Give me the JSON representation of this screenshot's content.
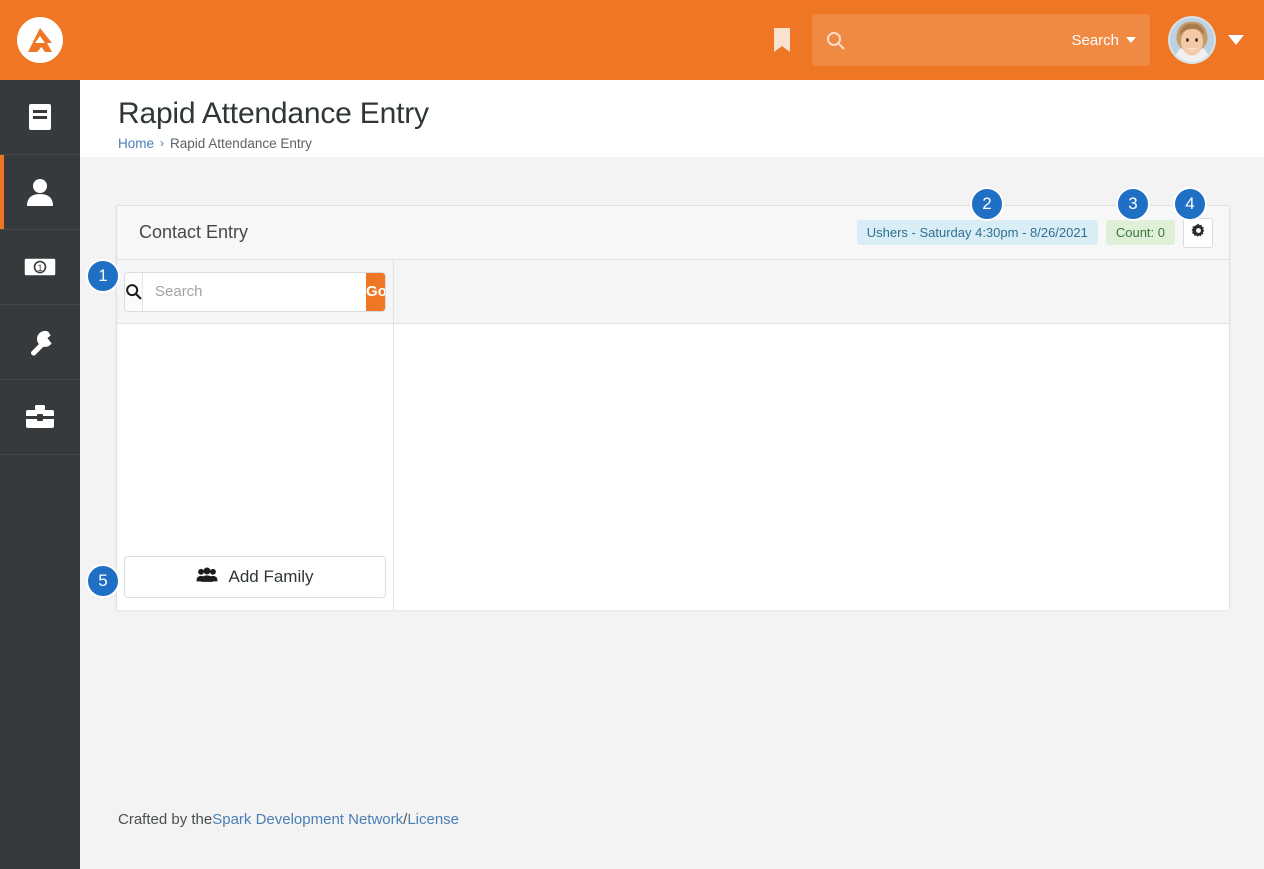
{
  "topbar": {
    "logo_icon": "rock-rms-logo",
    "bookmark_icon": "bookmark-icon",
    "search_icon": "search-icon",
    "search_value": "",
    "search_placeholder": "",
    "search_dropdown_label": "Search",
    "avatar_icon": "user-avatar",
    "avatar_caret_icon": "chevron-down-icon",
    "accent_color": "#ee7624"
  },
  "sidebar": {
    "items": [
      {
        "name": "book-icon",
        "label": "Content",
        "active": false
      },
      {
        "name": "person-icon",
        "label": "People",
        "active": true
      },
      {
        "name": "money-icon",
        "label": "Finance",
        "active": false
      },
      {
        "name": "wrench-icon",
        "label": "Admin",
        "active": false
      },
      {
        "name": "toolbox-icon",
        "label": "Tools",
        "active": false
      }
    ]
  },
  "page": {
    "title": "Rapid Attendance Entry",
    "breadcrumb": {
      "home": "Home",
      "separator": "›",
      "current": "Rapid Attendance Entry"
    }
  },
  "panel": {
    "title": "Contact Entry",
    "occurrence_badge": "Ushers - Saturday 4:30pm - 8/26/2021",
    "count_badge": "Count: 0",
    "settings_icon": "gear-icon",
    "badge_info_bg": "#d9edf7",
    "badge_info_fg": "#31708f",
    "badge_success_bg": "#dff0d8",
    "badge_success_fg": "#3c763d"
  },
  "search_panel": {
    "icon": "search-icon",
    "value": "",
    "placeholder": "Search",
    "go_label": "Go"
  },
  "add_family": {
    "icon": "users-icon",
    "label": "Add Family"
  },
  "callouts": [
    {
      "id": 1,
      "number": "1"
    },
    {
      "id": 2,
      "number": "2"
    },
    {
      "id": 3,
      "number": "3"
    },
    {
      "id": 4,
      "number": "4"
    },
    {
      "id": 5,
      "number": "5"
    }
  ],
  "footer": {
    "prefix": "Crafted by the ",
    "spark_link": "Spark Development Network",
    "divider": " / ",
    "license_link": "License"
  }
}
